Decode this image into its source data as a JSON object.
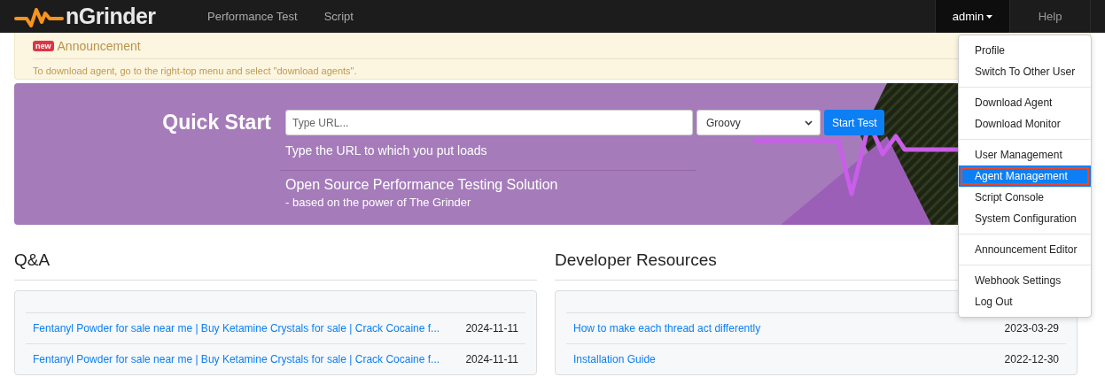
{
  "navbar": {
    "brand": "nGrinder",
    "links": [
      {
        "label": "Performance Test",
        "selected": false
      },
      {
        "label": "Script",
        "selected": false
      }
    ],
    "user": {
      "label": "admin",
      "expanded": true
    },
    "help": "Help"
  },
  "user_menu": {
    "groups": [
      {
        "items": [
          {
            "label": "Profile",
            "selected": false
          },
          {
            "label": "Switch To Other User",
            "selected": false
          }
        ]
      },
      {
        "items": [
          {
            "label": "Download Agent",
            "selected": false
          },
          {
            "label": "Download Monitor",
            "selected": false
          }
        ]
      },
      {
        "items": [
          {
            "label": "User Management",
            "selected": false
          },
          {
            "label": "Agent Management",
            "selected": true
          },
          {
            "label": "Script Console",
            "selected": false
          },
          {
            "label": "System Configuration",
            "selected": false
          }
        ]
      },
      {
        "items": [
          {
            "label": "Announcement Editor",
            "selected": false
          }
        ]
      },
      {
        "items": [
          {
            "label": "Webhook Settings",
            "selected": false
          },
          {
            "label": "Log Out",
            "selected": false
          }
        ]
      }
    ]
  },
  "announcement": {
    "badge": "new",
    "title": "Announcement",
    "text": "To download agent, go to the right-top menu and select \"download agents\"."
  },
  "quick_start": {
    "title": "Quick Start",
    "url_placeholder": "Type URL...",
    "script_type": "Groovy",
    "button": "Start Test",
    "hint": "Type the URL to which you put loads",
    "tagline": "Open Source Performance Testing Solution",
    "subtagline": "- based on the power of The Grinder"
  },
  "sections": [
    {
      "title": "Q&A",
      "rows": [
        {
          "title": "Fentanyl Powder for sale near me | Buy Ketamine Crystals for sale | Crack Cocaine f...",
          "date": "2024-11-11"
        },
        {
          "title": "Fentanyl Powder for sale near me | Buy Ketamine Crystals for sale | Crack Cocaine f...",
          "date": "2024-11-11"
        }
      ]
    },
    {
      "title": "Developer Resources",
      "rows": [
        {
          "title": "How to make each thread act differently",
          "date": "2023-03-29"
        },
        {
          "title": "Installation Guide",
          "date": "2022-12-30"
        }
      ]
    }
  ]
}
